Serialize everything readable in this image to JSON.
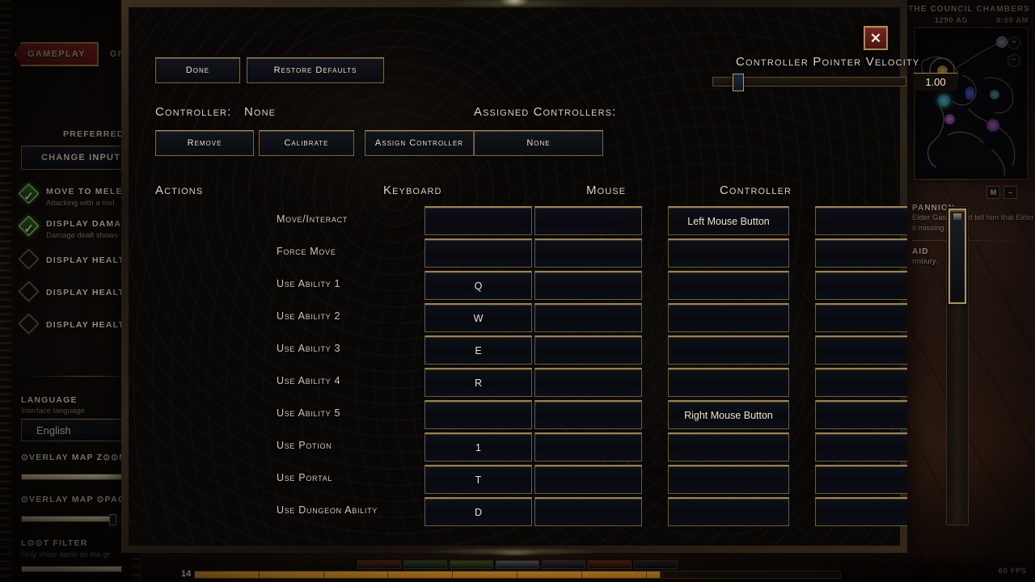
{
  "hud": {
    "map": {
      "location": "THE COUNCIL CHAMBERS",
      "year": "1290 AG",
      "time": "8:59 AM",
      "zoom_in_icon": "plus-icon",
      "zoom_out_icon": "minus-icon",
      "map_key_label": "M",
      "map_minimize_label": "–"
    },
    "quests": [
      {
        "title": "PANNION",
        "body": "Elder Gaspar and tell him that Elder s missing."
      },
      {
        "title": "AID",
        "body": "rmoury."
      }
    ],
    "level": "14",
    "fps": "60 FPS",
    "xp_percent": 72
  },
  "settings_panel": {
    "tabs": [
      {
        "label": "GAMEPLAY",
        "active": true
      },
      {
        "label": "GR",
        "active": false
      }
    ],
    "preferred_label": "PREFERRED I",
    "change_input_button": "CHANGE INPUT KE",
    "options": [
      {
        "label": "MOVE TO MELEE",
        "sub": "Attacking with a mel",
        "checked": true
      },
      {
        "label": "DISPLAY DAMAGE",
        "sub": "Damage dealt shows",
        "checked": true
      },
      {
        "label": "DISPLAY HEALTH",
        "sub": "",
        "checked": false
      },
      {
        "label": "DISPLAY HEALTH",
        "sub": "",
        "checked": false
      },
      {
        "label": "DISPLAY HEALTH",
        "sub": "",
        "checked": false
      }
    ],
    "language": {
      "label": "LANGUAGE",
      "sub": "Interface language",
      "value": "English"
    },
    "overlay_map_zoom": {
      "label": "⊙VERLAY MAP Z⊙⊙M",
      "percent": 100
    },
    "overlay_map_opacity": {
      "label": "⊙VERLAY MAP ⊙PACITY",
      "percent": 92
    },
    "loot_filter": {
      "label": "L⊙⊙T FILTER",
      "sub": "Only show items on the gr"
    }
  },
  "dialog": {
    "close_icon": "close-icon",
    "buttons": {
      "done": "Done",
      "restore_defaults": "Restore Defaults"
    },
    "velocity": {
      "title": "Controller pointer velocity",
      "value": "1.00",
      "percent": 13
    },
    "controller": {
      "label": "Controller:",
      "value": "None",
      "remove": "Remove",
      "calibrate": "Calibrate",
      "assign": "Assign Controller"
    },
    "assigned": {
      "label": "Assigned Controllers:",
      "value": "None"
    },
    "columns": [
      "Actions",
      "Keyboard",
      "Mouse",
      "Controller"
    ],
    "rows": [
      {
        "action": "Move/Interact",
        "key1": "",
        "key2": "",
        "mouse": "Left Mouse Button",
        "controller": ""
      },
      {
        "action": "Force Move",
        "key1": "",
        "key2": "",
        "mouse": "",
        "controller": ""
      },
      {
        "action": "Use Ability 1",
        "key1": "Q",
        "key2": "",
        "mouse": "",
        "controller": ""
      },
      {
        "action": "Use Ability 2",
        "key1": "W",
        "key2": "",
        "mouse": "",
        "controller": ""
      },
      {
        "action": "Use Ability 3",
        "key1": "E",
        "key2": "",
        "mouse": "",
        "controller": ""
      },
      {
        "action": "Use Ability 4",
        "key1": "R",
        "key2": "",
        "mouse": "",
        "controller": ""
      },
      {
        "action": "Use Ability 5",
        "key1": "",
        "key2": "",
        "mouse": "Right Mouse Button",
        "controller": ""
      },
      {
        "action": "Use Potion",
        "key1": "1",
        "key2": "",
        "mouse": "",
        "controller": ""
      },
      {
        "action": "Use Portal",
        "key1": "T",
        "key2": "",
        "mouse": "",
        "controller": ""
      },
      {
        "action": "Use Dungeon Ability",
        "key1": "D",
        "key2": "",
        "mouse": "",
        "controller": ""
      }
    ],
    "scroll_thumb_percent": 30
  },
  "colors": {
    "gold": "#9c8347",
    "accent_red": "#a32a20",
    "xp_orange": "#f0a92b",
    "text": "#e8dcc2"
  }
}
